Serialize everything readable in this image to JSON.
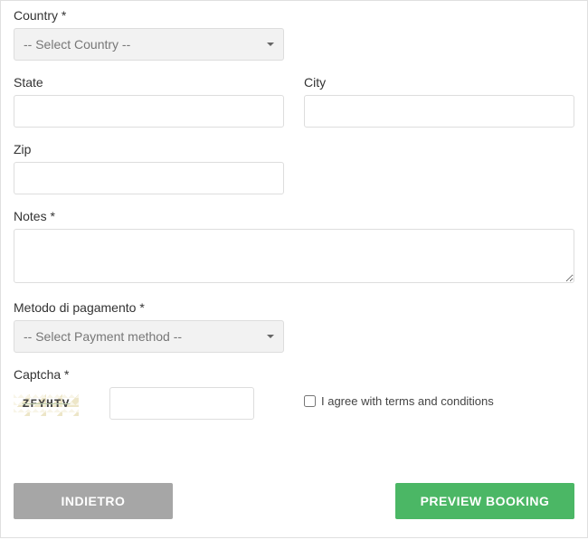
{
  "fields": {
    "country": {
      "label": "Country *",
      "placeholder": "-- Select Country --"
    },
    "state": {
      "label": "State"
    },
    "city": {
      "label": "City"
    },
    "zip": {
      "label": "Zip"
    },
    "notes": {
      "label": "Notes *"
    },
    "payment": {
      "label": "Metodo di pagamento *",
      "placeholder": "-- Select Payment method --"
    },
    "captcha": {
      "label": "Captcha *",
      "image_text": "ZFYHTV"
    }
  },
  "terms": {
    "label": "I agree with terms and conditions"
  },
  "buttons": {
    "back": "INDIETRO",
    "preview": "PREVIEW BOOKING"
  }
}
